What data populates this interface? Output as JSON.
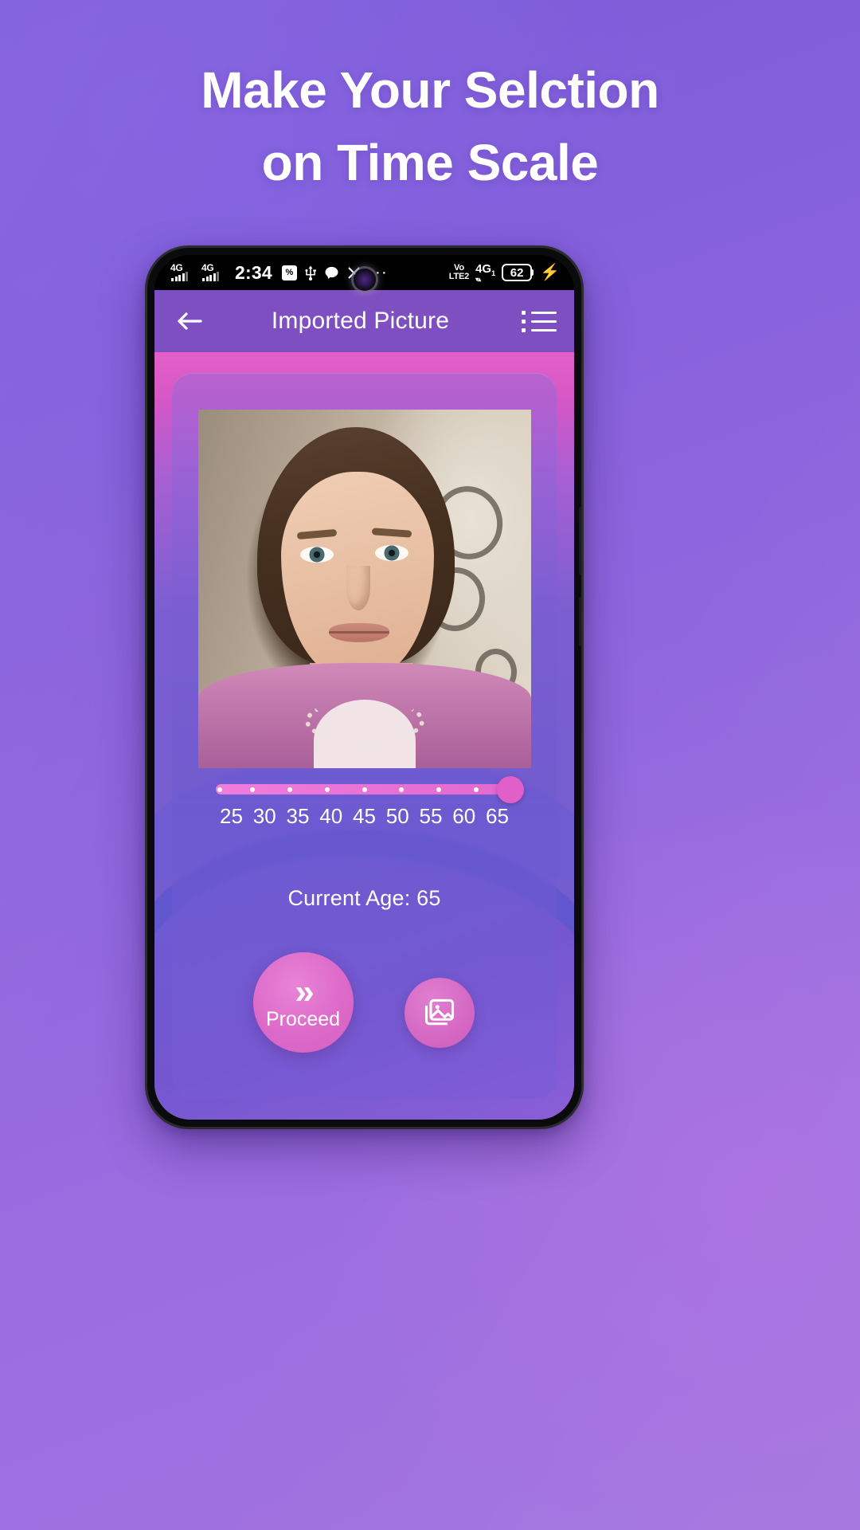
{
  "promo": {
    "headline_line1": "Make Your Selction",
    "headline_line2": "on Time Scale"
  },
  "phone": {
    "status_bar": {
      "network_1": "4G",
      "network_2": "4G",
      "time": "2:34",
      "vibrate_icon": "vibrate-icon",
      "usb_icon": "usb-icon",
      "message_icon": "message-bubble-icon",
      "tools_icon": "tools-icon",
      "more_icon": "···",
      "volte_label": "VoLTE 2",
      "network_right": "4G",
      "battery_level": "62",
      "charging_icon": "⚡"
    },
    "toolbar": {
      "back_icon": "arrow-left-icon",
      "title": "Imported Picture",
      "menu_icon": "list-menu-icon"
    },
    "main": {
      "photo_alt": "imported portrait photo",
      "slider": {
        "ticks": [
          "25",
          "30",
          "35",
          "40",
          "45",
          "50",
          "55",
          "60",
          "65"
        ],
        "min": 25,
        "max": 65,
        "value": 65,
        "track_color": "#e973d6",
        "thumb_color": "#e15fc9"
      },
      "current_age_label": "Current Age: 65",
      "proceed_button": {
        "icon": "double-chevron-right-icon",
        "label": "Proceed"
      },
      "gallery_button": {
        "icon": "image-picture-icon"
      }
    }
  }
}
